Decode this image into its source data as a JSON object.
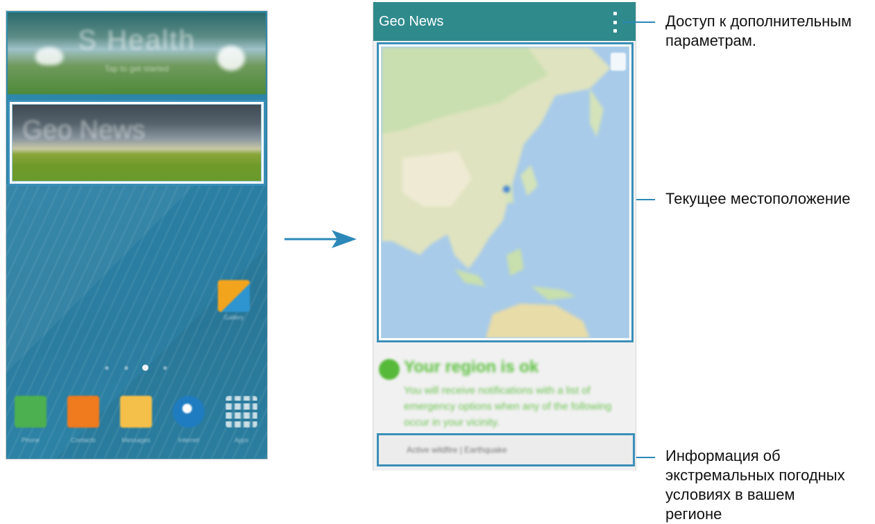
{
  "left_screen": {
    "shealth_card": {
      "title": "S Health",
      "subtitle": "Tap to get started"
    },
    "geonews_card": {
      "title": "Geo News"
    },
    "apps": {
      "gallery": "Gallery",
      "phone": "Phone",
      "contacts": "Contacts",
      "messages": "Messages",
      "internet": "Internet",
      "apps": "Apps"
    }
  },
  "right_screen": {
    "app_bar": {
      "title": "Geo News",
      "menu_icon": "overflow-menu-icon"
    },
    "map": {
      "icon": "location-pin-icon"
    },
    "status": {
      "title": "Your region is ok",
      "text": "You will receive notifications with a list of emergency options when any of the following occur in your vicinity."
    },
    "alerts": {
      "text": "Active wildfire | Earthquake"
    }
  },
  "callouts": {
    "menu": [
      "Доступ к дополнительным",
      "параметрам."
    ],
    "location": [
      "Текущее местоположение"
    ],
    "alerts": [
      "Информация об",
      "экстремальных погодных",
      "условиях в вашем",
      "регионе"
    ]
  },
  "colors": {
    "accent": "#2b88b8",
    "app_bar": "#2f8a8c",
    "status_ok": "#5cc03f"
  }
}
